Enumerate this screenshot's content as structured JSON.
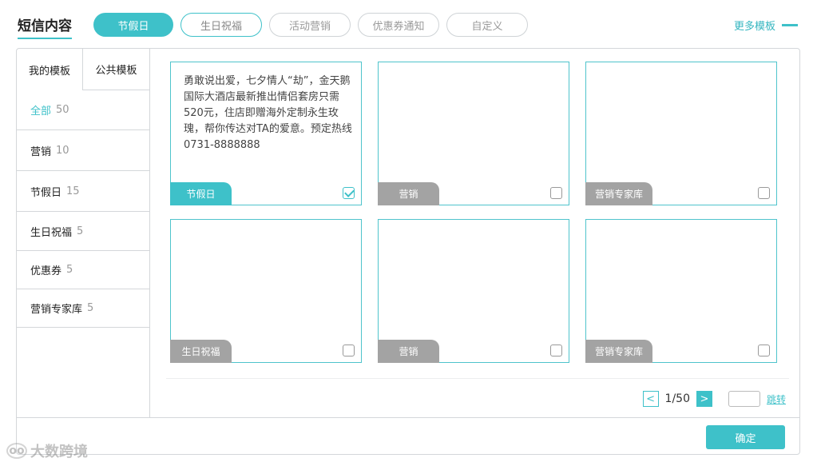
{
  "header": {
    "title": "短信内容",
    "tabs": [
      {
        "label": "节假日"
      },
      {
        "label": "生日祝福"
      },
      {
        "label": "活动营销"
      },
      {
        "label": "优惠券通知"
      },
      {
        "label": "自定义"
      }
    ],
    "more_label": "更多模板"
  },
  "sidebar": {
    "tabs": [
      "我的模板",
      "公共模板"
    ],
    "categories": [
      {
        "label": "全部",
        "count": "50"
      },
      {
        "label": "营销",
        "count": "10"
      },
      {
        "label": "节假日",
        "count": "15"
      },
      {
        "label": "生日祝福",
        "count": "5"
      },
      {
        "label": "优惠券",
        "count": "5"
      },
      {
        "label": "营销专家库",
        "count": "5"
      }
    ]
  },
  "cards": [
    {
      "text": "勇敢说出爱，七夕情人“劫”，金天鹅国际大酒店最新推出情侣套房只需520元，住店即赠海外定制永生玫瑰，帮你传达对TA的爱意。预定热线0731-8888888",
      "tag": "节假日",
      "checked": true
    },
    {
      "text": "",
      "tag": "营销",
      "checked": false
    },
    {
      "text": "",
      "tag": "营销专家库",
      "checked": false
    },
    {
      "text": "",
      "tag": "生日祝福",
      "checked": false
    },
    {
      "text": "",
      "tag": "营销",
      "checked": false
    },
    {
      "text": "",
      "tag": "营销专家库",
      "checked": false
    }
  ],
  "pager": {
    "prev": "<",
    "next": ">",
    "text": "1/50",
    "jump": "跳转"
  },
  "confirm_label": "确定",
  "watermark": "大数跨境",
  "colors": {
    "accent": "#3ec1c9",
    "tag_gray": "#a3a3a3"
  }
}
